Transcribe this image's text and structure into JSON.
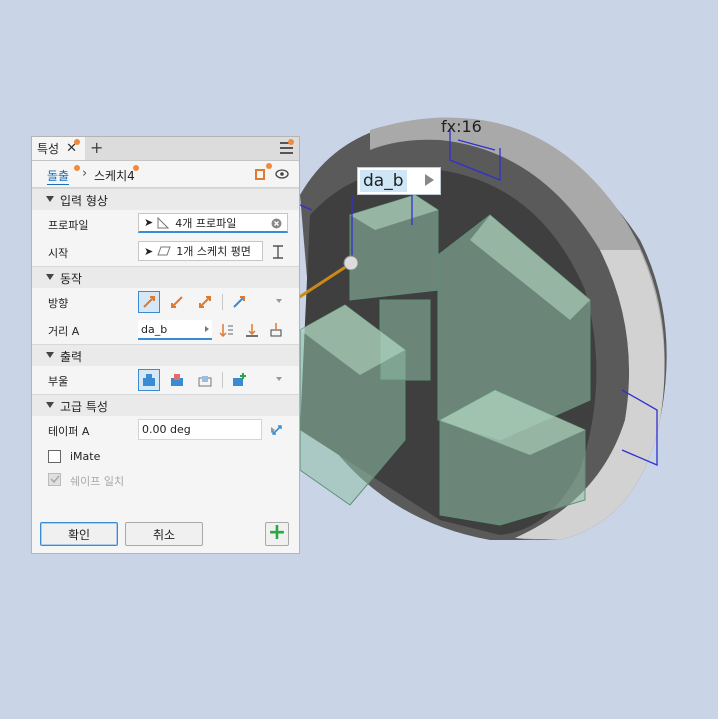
{
  "viewport": {
    "dimension_value": "da_b",
    "fx_label": "fx:16"
  },
  "panel": {
    "tab_label": "특성",
    "breadcrumb": {
      "feature": "돌출",
      "sketch": "스케치4"
    },
    "sections": {
      "input_geometry": "입력 형상",
      "behavior": "동작",
      "output": "출력",
      "advanced": "고급 특성"
    },
    "fields": {
      "profile_label": "프로파일",
      "profile_value": "4개 프로파일",
      "start_label": "시작",
      "start_value": "1개 스케치 평면",
      "direction_label": "방향",
      "distance_label": "거리 A",
      "distance_value": "da_b",
      "boolean_label": "부울",
      "taper_label": "테이퍼 A",
      "taper_value": "0.00 deg",
      "imate_label": "iMate",
      "match_shape_label": "쉐이프 일치"
    },
    "buttons": {
      "ok": "확인",
      "cancel": "취소"
    }
  },
  "colors": {
    "accent": "#3a8cd2",
    "badge": "#f08a3c",
    "add": "#2aa842"
  }
}
